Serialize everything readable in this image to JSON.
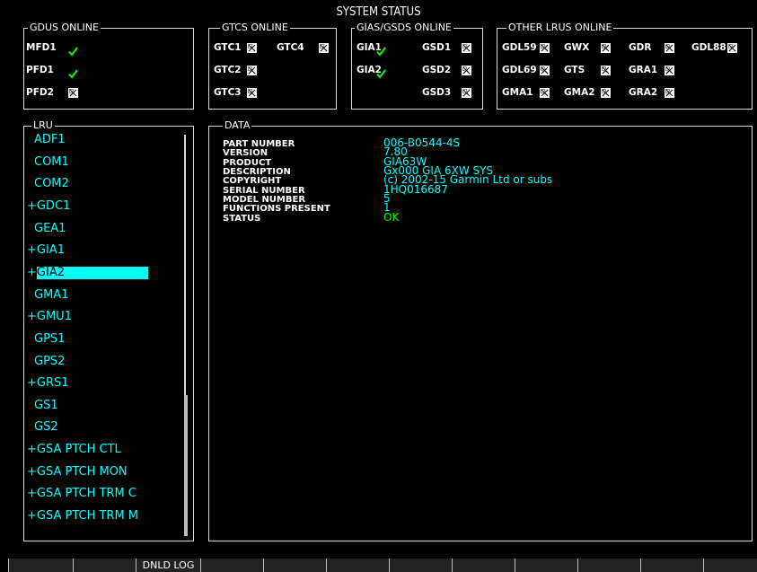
{
  "screen": {
    "title": "SYSTEM STATUS"
  },
  "panels": {
    "gdus": {
      "title": "GDUS ONLINE",
      "items": [
        {
          "label": "MFD1",
          "status": "ok"
        },
        {
          "label": "PFD1",
          "status": "ok"
        },
        {
          "label": "PFD2",
          "status": "fail"
        }
      ]
    },
    "gtcs": {
      "title": "GTCS ONLINE",
      "items": [
        {
          "label": "GTC1",
          "status": "fail"
        },
        {
          "label": "GTC4",
          "status": "fail"
        },
        {
          "label": "GTC2",
          "status": "fail"
        },
        {
          "label": "GTC3",
          "status": "fail"
        }
      ]
    },
    "gias": {
      "title": "GIAS/GSDS ONLINE",
      "items": [
        {
          "label": "GIA1",
          "status": "ok"
        },
        {
          "label": "GSD1",
          "status": "fail"
        },
        {
          "label": "GIA2",
          "status": "ok"
        },
        {
          "label": "GSD2",
          "status": "fail"
        },
        {
          "label": "GSD3",
          "status": "fail"
        }
      ]
    },
    "other": {
      "title": "OTHER LRUS ONLINE",
      "items": [
        {
          "label": "GDL59",
          "status": "fail"
        },
        {
          "label": "GWX",
          "status": "fail"
        },
        {
          "label": "GDR",
          "status": "fail"
        },
        {
          "label": "GDL88",
          "status": "fail"
        },
        {
          "label": "GDL69",
          "status": "fail"
        },
        {
          "label": "GTS",
          "status": "fail"
        },
        {
          "label": "GRA1",
          "status": "fail"
        },
        {
          "label": "GMA1",
          "status": "fail"
        },
        {
          "label": "GMA2",
          "status": "fail"
        },
        {
          "label": "GRA2",
          "status": "fail"
        }
      ]
    }
  },
  "lru": {
    "title": "LRU",
    "selected_index": 6,
    "items": [
      "ADF1",
      "COM1",
      "COM2",
      "+GDC1",
      "GEA1",
      "+GIA1",
      "+GIA2",
      "GMA1",
      "+GMU1",
      "GPS1",
      "GPS2",
      "+GRS1",
      "GS1",
      "GS2",
      "+GSA PTCH CTL",
      "+GSA PTCH MON",
      "+GSA PTCH TRM C",
      "+GSA PTCH TRM M"
    ]
  },
  "data": {
    "title": "DATA",
    "rows": [
      {
        "key": "PART NUMBER",
        "value": "006-B0544-4S"
      },
      {
        "key": "VERSION",
        "value": "7.80"
      },
      {
        "key": "PRODUCT",
        "value": "GIA63W"
      },
      {
        "key": "DESCRIPTION",
        "value": "Gx000 GIA 6XW SYS"
      },
      {
        "key": "COPYRIGHT",
        "value": "(c) 2002-15 Garmin Ltd or subs"
      },
      {
        "key": "SERIAL NUMBER",
        "value": "1HQ016687"
      },
      {
        "key": "MODEL NUMBER",
        "value": "5"
      },
      {
        "key": "FUNCTIONS PRESENT",
        "value": "1"
      },
      {
        "key": "STATUS",
        "value": "OK"
      }
    ],
    "status_color": "#00ff00"
  },
  "softkeys": [
    "",
    "",
    "DNLD LOG",
    "",
    "",
    "",
    "",
    "",
    "",
    "",
    "",
    ""
  ],
  "colors": {
    "cyan": "#00ffff",
    "green": "#00ff00",
    "background": "#000000"
  },
  "icons": {
    "ok": "check-box-icon",
    "fail": "failed-cross-icon"
  }
}
